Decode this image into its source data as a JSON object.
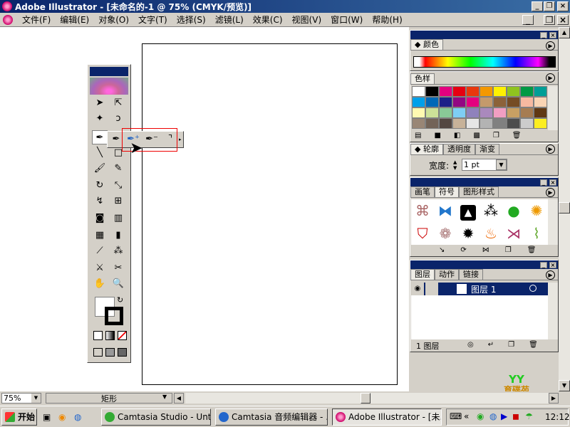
{
  "window": {
    "title": "Adobe Illustrator - [未命名的-1 @ 75% (CMYK/预览)]"
  },
  "menu": [
    "文件(F)",
    "编辑(E)",
    "对象(O)",
    "文字(T)",
    "选择(S)",
    "滤镜(L)",
    "效果(C)",
    "视图(V)",
    "窗口(W)",
    "帮助(H)"
  ],
  "color_panel": {
    "tab": "颜色"
  },
  "swatches_panel": {
    "tab": "色样",
    "colors": [
      "#ffffff",
      "#000000",
      "#e4007f",
      "#e60012",
      "#e8380d",
      "#f39800",
      "#fff100",
      "#8fc31f",
      "#009944",
      "#009e96",
      "#00a0e9",
      "#0068b7",
      "#1d2088",
      "#920783",
      "#e4007f",
      "#c49a6c",
      "#8c6239",
      "#754c24",
      "#f7b9a1",
      "#fad4b4",
      "#fff9b1",
      "#cce198",
      "#89c997",
      "#7ecef4",
      "#8f82bc",
      "#aa89bd",
      "#f19ec2",
      "#c8a063",
      "#a67c52",
      "#603813",
      "#998675",
      "#736357",
      "#534741",
      "#c7b299",
      "#e6e6e6",
      "#b3b3b3",
      "#808080",
      "#4d4d4d",
      "#cccccc",
      "#fcee21"
    ]
  },
  "stroke_panel": {
    "tabs": [
      "轮廓",
      "透明度",
      "渐变"
    ],
    "width_label": "宽度:",
    "width_value": "1 pt"
  },
  "symbols_panel": {
    "tabs": [
      "画笔",
      "符号",
      "图形样式"
    ],
    "symbols": [
      "bracket-ornament",
      "blue-butterfly",
      "triangle-logo",
      "grapes",
      "green-apple",
      "yellow-fish",
      "red-shield",
      "paisley-swirl",
      "black-star",
      "flames",
      "fish-outline",
      "bamboo"
    ]
  },
  "layers_panel": {
    "tabs": [
      "图层",
      "动作",
      "链接"
    ],
    "layer_name": "图层 1",
    "footer": "1 图层"
  },
  "status": {
    "zoom": "75%",
    "tool": "矩形"
  },
  "watermark": "育碟苑",
  "taskbar": {
    "start": "开始",
    "tasks": [
      "Camtasia Studio - Untitl...",
      "Camtasia 音频编辑器 - ...",
      "Adobe Illustrator - [未..."
    ],
    "time": "12:12"
  },
  "colors": {
    "titlebar": "#0a246a",
    "accent_red": "#e00000"
  }
}
